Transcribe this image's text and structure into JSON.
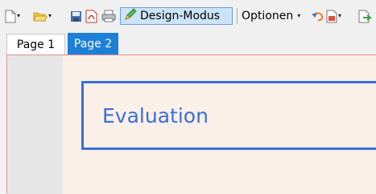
{
  "toolbar": {
    "icons": [
      "new-document-icon",
      "open-folder-icon",
      "save-icon",
      "pdf-icon",
      "print-icon",
      "pencil-icon",
      "undo-icon",
      "document-icon",
      "export-icon"
    ],
    "design_mode_label": "Design-Modus",
    "options_label": "Optionen"
  },
  "tabs": [
    {
      "label": "Page 1",
      "active": true
    },
    {
      "label": "Page 2",
      "active": false
    }
  ],
  "page": {
    "box_text": "Evaluation"
  },
  "colors": {
    "accent_blue": "#3a6fd9",
    "tab_active_bg": "#1d7fd8",
    "page_bg": "#fbf0e8",
    "border_red": "#e78a88"
  }
}
